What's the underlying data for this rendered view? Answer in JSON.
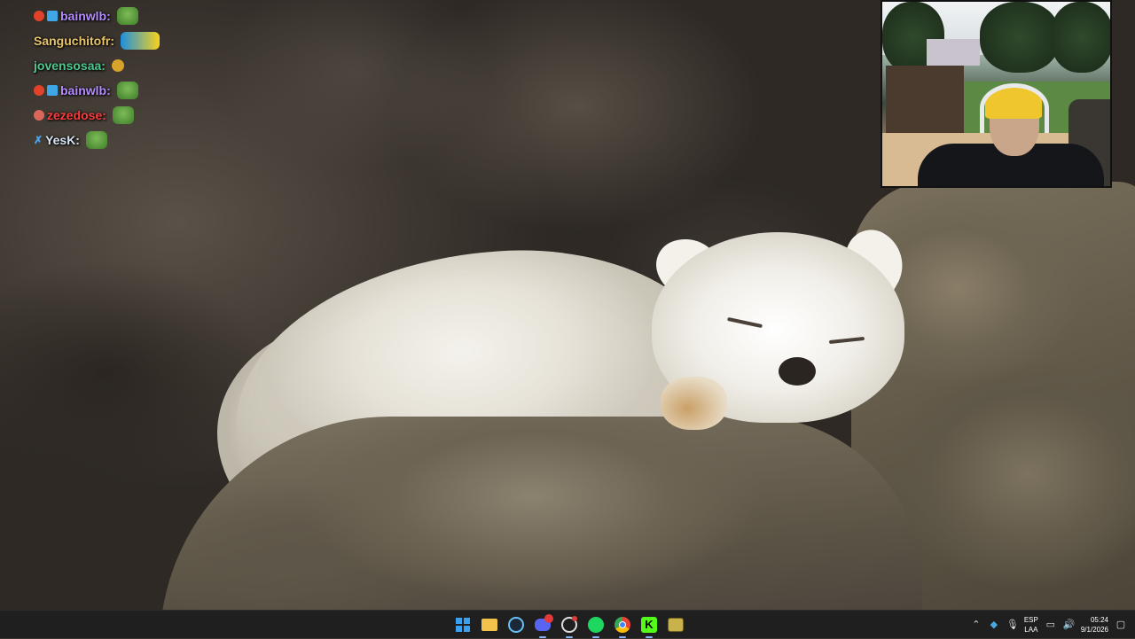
{
  "chat": {
    "messages": [
      {
        "user": "bainwlb:",
        "color": "#b48cff",
        "emote": "frog"
      },
      {
        "user": "Sanguchitofr:",
        "color": "#e6c46a",
        "emote": "laugh"
      },
      {
        "user": "jovensosaa:",
        "color": "#4fc98f",
        "emote": "small"
      },
      {
        "user": "bainwlb:",
        "color": "#b48cff",
        "emote": "frog"
      },
      {
        "user": "zezedose:",
        "color": "#ff3b3b",
        "emote": "frog"
      },
      {
        "user": "YesK:",
        "color": "#d7e3f5",
        "emote": "frog"
      }
    ]
  },
  "taskbar": {
    "apps": [
      "windows-start",
      "file-explorer",
      "steam",
      "discord",
      "obs",
      "spotify",
      "chrome",
      "kick",
      "game"
    ],
    "discord_badge": "",
    "language": {
      "top": "ESP",
      "bottom": "LAA"
    },
    "clock": {
      "time": "05:24",
      "date": "9/1/2026"
    }
  }
}
